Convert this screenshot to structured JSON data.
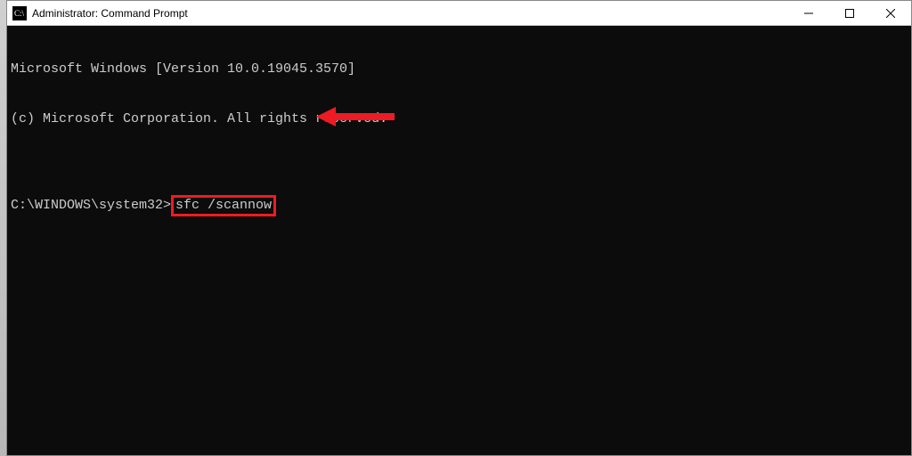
{
  "titlebar": {
    "title": "Administrator: Command Prompt"
  },
  "window_controls": {
    "minimize": "─",
    "maximize": "☐",
    "close": "✕"
  },
  "console": {
    "line1": "Microsoft Windows [Version 10.0.19045.3570]",
    "line2": "(c) Microsoft Corporation. All rights reserved.",
    "blank": "",
    "prompt_prefix": "C:\\WINDOWS\\system32>",
    "command": "sfc /scannow"
  },
  "annotation": {
    "highlight_color": "#ee1b24",
    "arrow_color": "#ee1b24"
  }
}
